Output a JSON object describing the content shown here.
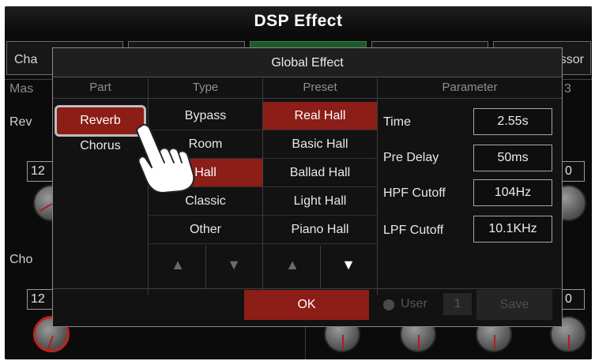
{
  "app": {
    "title": "DSP Effect",
    "background_tabs": [
      "Cha",
      "ssor"
    ],
    "background_labels": {
      "master": "Mas",
      "right_num": "3",
      "rev": "Rev",
      "cho": "Cho",
      "value_a": "12",
      "value_b": "12",
      "value_c": "0",
      "value_d": "0"
    }
  },
  "dialog": {
    "title": "Global Effect",
    "columns": {
      "part": "Part",
      "type": "Type",
      "preset": "Preset",
      "parameter": "Parameter"
    },
    "parts": [
      {
        "label": "Reverb",
        "selected": true
      },
      {
        "label": "Chorus",
        "selected": false
      }
    ],
    "types": [
      {
        "label": "Bypass",
        "selected": false
      },
      {
        "label": "Room",
        "selected": false
      },
      {
        "label": "Hall",
        "selected": true
      },
      {
        "label": "Classic",
        "selected": false
      },
      {
        "label": "Other",
        "selected": false
      }
    ],
    "presets": [
      {
        "label": "Real Hall",
        "selected": true
      },
      {
        "label": "Basic Hall",
        "selected": false
      },
      {
        "label": "Ballad Hall",
        "selected": false
      },
      {
        "label": "Light Hall",
        "selected": false
      },
      {
        "label": "Piano Hall",
        "selected": false
      }
    ],
    "parameters": [
      {
        "label": "Time",
        "value": "2.55s"
      },
      {
        "label": "Pre Delay",
        "value": "50ms"
      },
      {
        "label": "HPF Cutoff",
        "value": "104Hz"
      },
      {
        "label": "LPF Cutoff",
        "value": "10.1KHz"
      }
    ],
    "arrows": {
      "type_up": "▲",
      "type_down": "▼",
      "preset_up": "▲",
      "preset_down": "▼"
    },
    "ok_label": "OK",
    "user_label": "User",
    "user_number": "1",
    "save_label": "Save"
  },
  "colors": {
    "accent_red": "#8c1d17",
    "tab_green": "#1d5a2a"
  },
  "icons": {
    "pointer": "hand-pointer-icon"
  }
}
